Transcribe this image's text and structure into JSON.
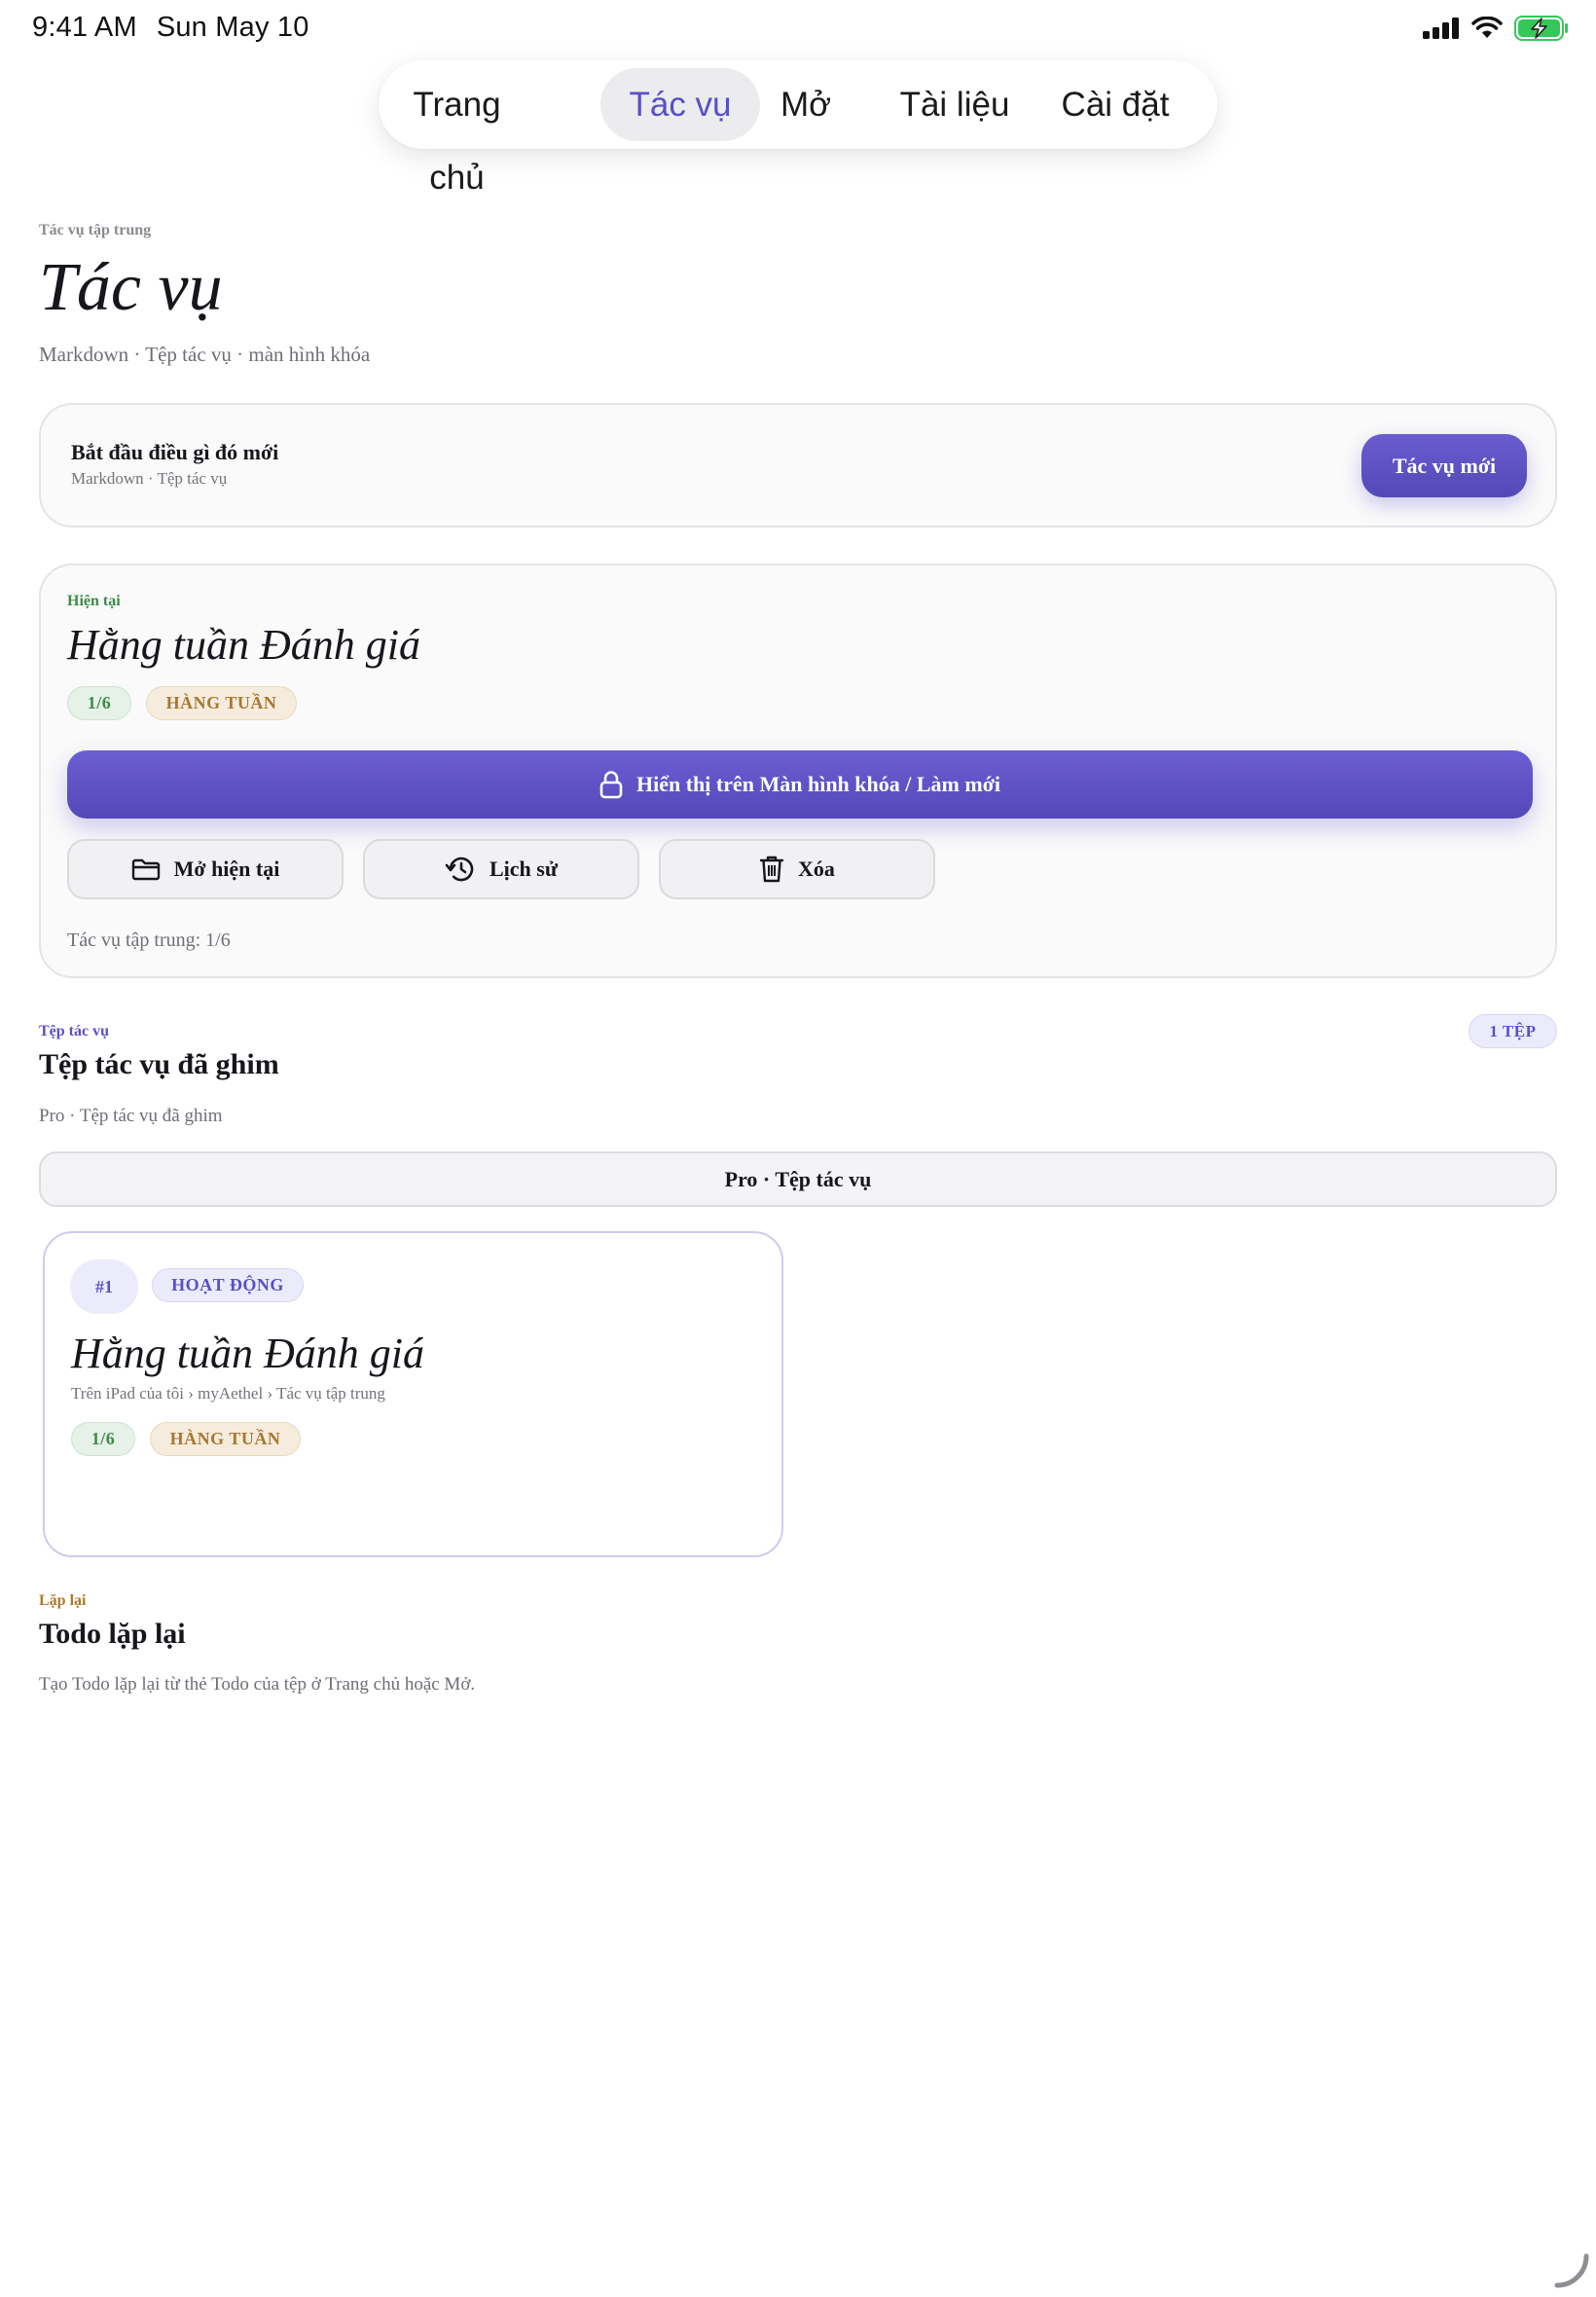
{
  "status": {
    "time": "9:41 AM",
    "date": "Sun May 10"
  },
  "nav": {
    "tabs": [
      {
        "label": "Trang chủ"
      },
      {
        "label": "Tác vụ",
        "active": true
      },
      {
        "label": "Mở"
      },
      {
        "label": "Tài liệu"
      },
      {
        "label": "Cài đặt"
      }
    ]
  },
  "header": {
    "eyebrow": "Tác vụ tập trung",
    "title": "Tác vụ",
    "subtitle": "Markdown · Tệp tác vụ · màn hình khóa"
  },
  "new_card": {
    "title": "Bắt đầu điều gì đó mới",
    "subtitle": "Markdown · Tệp tác vụ",
    "button": "Tác vụ mới"
  },
  "current": {
    "label": "Hiện tại",
    "title": "Hằng tuần Đánh giá",
    "progress": "1/6",
    "frequency": "HÀNG TUẦN",
    "lock_button": "Hiển thị trên Màn hình khóa / Làm mới",
    "open_button": "Mở hiện tại",
    "history_button": "Lịch sử",
    "delete_button": "Xóa",
    "focus_text": "Tác vụ tập trung: 1/6"
  },
  "pinned": {
    "eyebrow": "Tệp tác vụ",
    "title": "Tệp tác vụ đã ghim",
    "subtitle": "Pro · Tệp tác vụ đã ghim",
    "count_badge": "1 TỆP",
    "pro_bar": "Pro · Tệp tác vụ",
    "item": {
      "number": "#1",
      "state": "HOẠT ĐỘNG",
      "title": "Hằng tuần Đánh giá",
      "path": "Trên iPad của tôi › myAethel › Tác vụ tập trung",
      "progress": "1/6",
      "frequency": "HÀNG TUẦN"
    }
  },
  "repeat": {
    "eyebrow": "Lặp lại",
    "title": "Todo lặp lại",
    "subtitle": "Tạo Todo lặp lại từ thẻ Todo của tệp ở Trang chủ hoặc Mở."
  },
  "colors": {
    "accent": "#5a4fc8",
    "green": "#3e8a4a",
    "tan": "#a8782f",
    "battery": "#34c759"
  },
  "icons": [
    "signal-icon",
    "wifi-icon",
    "battery-charging-icon",
    "lock-icon",
    "folder-icon",
    "history-icon",
    "trash-icon"
  ]
}
